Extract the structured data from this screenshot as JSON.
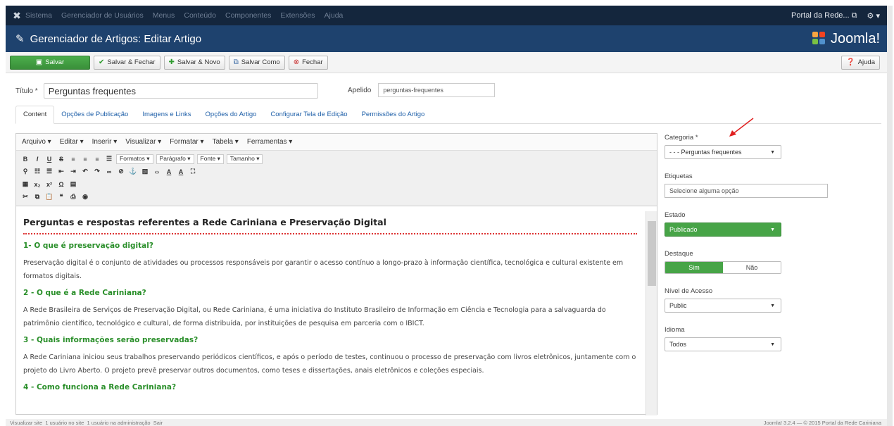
{
  "topbar": {
    "menu": [
      "Sistema",
      "Gerenciador de Usuários",
      "Menus",
      "Conteúdo",
      "Componentes",
      "Extensões",
      "Ajuda"
    ],
    "site_link": "Portal da Rede...",
    "gear_caret": "▾"
  },
  "header": {
    "title": "Gerenciador de Artigos: Editar Artigo",
    "brand": "Joomla!"
  },
  "toolbar": {
    "save": "Salvar",
    "save_close": "Salvar & Fechar",
    "save_new": "Salvar & Novo",
    "save_copy": "Salvar Como",
    "close": "Fechar",
    "help": "Ajuda"
  },
  "form": {
    "title_label": "Título *",
    "title_value": "Perguntas frequentes",
    "alias_label": "Apelido",
    "alias_value": "perguntas-frequentes"
  },
  "tabs": [
    "Content",
    "Opções de Publicação",
    "Imagens e Links",
    "Opções do Artigo",
    "Configurar Tela de Edição",
    "Permissões do Artigo"
  ],
  "editor": {
    "menu": [
      "Arquivo ▾",
      "Editar ▾",
      "Inserir ▾",
      "Visualizar ▾",
      "Formatar ▾",
      "Tabela ▾",
      "Ferramentas ▾"
    ],
    "formats": "Formatos ▾",
    "paragraph": "Parágrafo ▾",
    "font": "Fonte ▾",
    "size": "Tamanho ▾",
    "heading": "Perguntas e respostas referentes a Rede Cariniana e Preservação Digital",
    "q1": "1- O que é preservação digital?",
    "a1": "Preservação digital é o conjunto de atividades ou processos responsáveis por garantir o acesso contínuo a longo-prazo à informação científica, tecnológica e cultural existente em formatos digitais.",
    "q2": "2 - O que é a Rede Cariniana?",
    "a2": "A Rede Brasileira de Serviços de Preservação Digital, ou Rede Cariniana, é uma iniciativa do Instituto Brasileiro de Informação em Ciência e Tecnologia para a salvaguarda do patrimônio científico, tecnológico e cultural, de forma distribuída, por instituições de pesquisa em parceria com o IBICT.",
    "q3": "3 - Quais informações serão preservadas?",
    "a3": "A Rede Cariniana iniciou seus trabalhos preservando periódicos científicos, e após o período de testes, continuou o processo de preservação com livros eletrônicos, juntamente com o projeto do Livro Aberto. O projeto prevê preservar outros documentos, como teses e dissertações, anais eletrônicos e coleções especiais.",
    "q4": "4 - Como funciona a Rede Cariniana?"
  },
  "sidebar": {
    "category_label": "Categoria *",
    "category_value": "- - - Perguntas frequentes",
    "tags_label": "Etiquetas",
    "tags_placeholder": "Selecione alguma opção",
    "state_label": "Estado",
    "state_value": "Publicado",
    "featured_label": "Destaque",
    "featured_yes": "Sim",
    "featured_no": "Não",
    "access_label": "Nível de Acesso",
    "access_value": "Public",
    "language_label": "Idioma",
    "language_value": "Todos"
  },
  "footer": {
    "view_site": "Visualizar site",
    "visitors": "1 usuário no site",
    "admins": "1 usuário na administração",
    "logout": "Sair",
    "version": "Joomla! 3.2.4 — © 2015 Portal da Rede Cariniana"
  },
  "colors": {
    "topbar": "#14263d",
    "header": "#1e426e",
    "green": "#47a447",
    "link": "#1e5fa8",
    "arrow": "#e02020"
  }
}
